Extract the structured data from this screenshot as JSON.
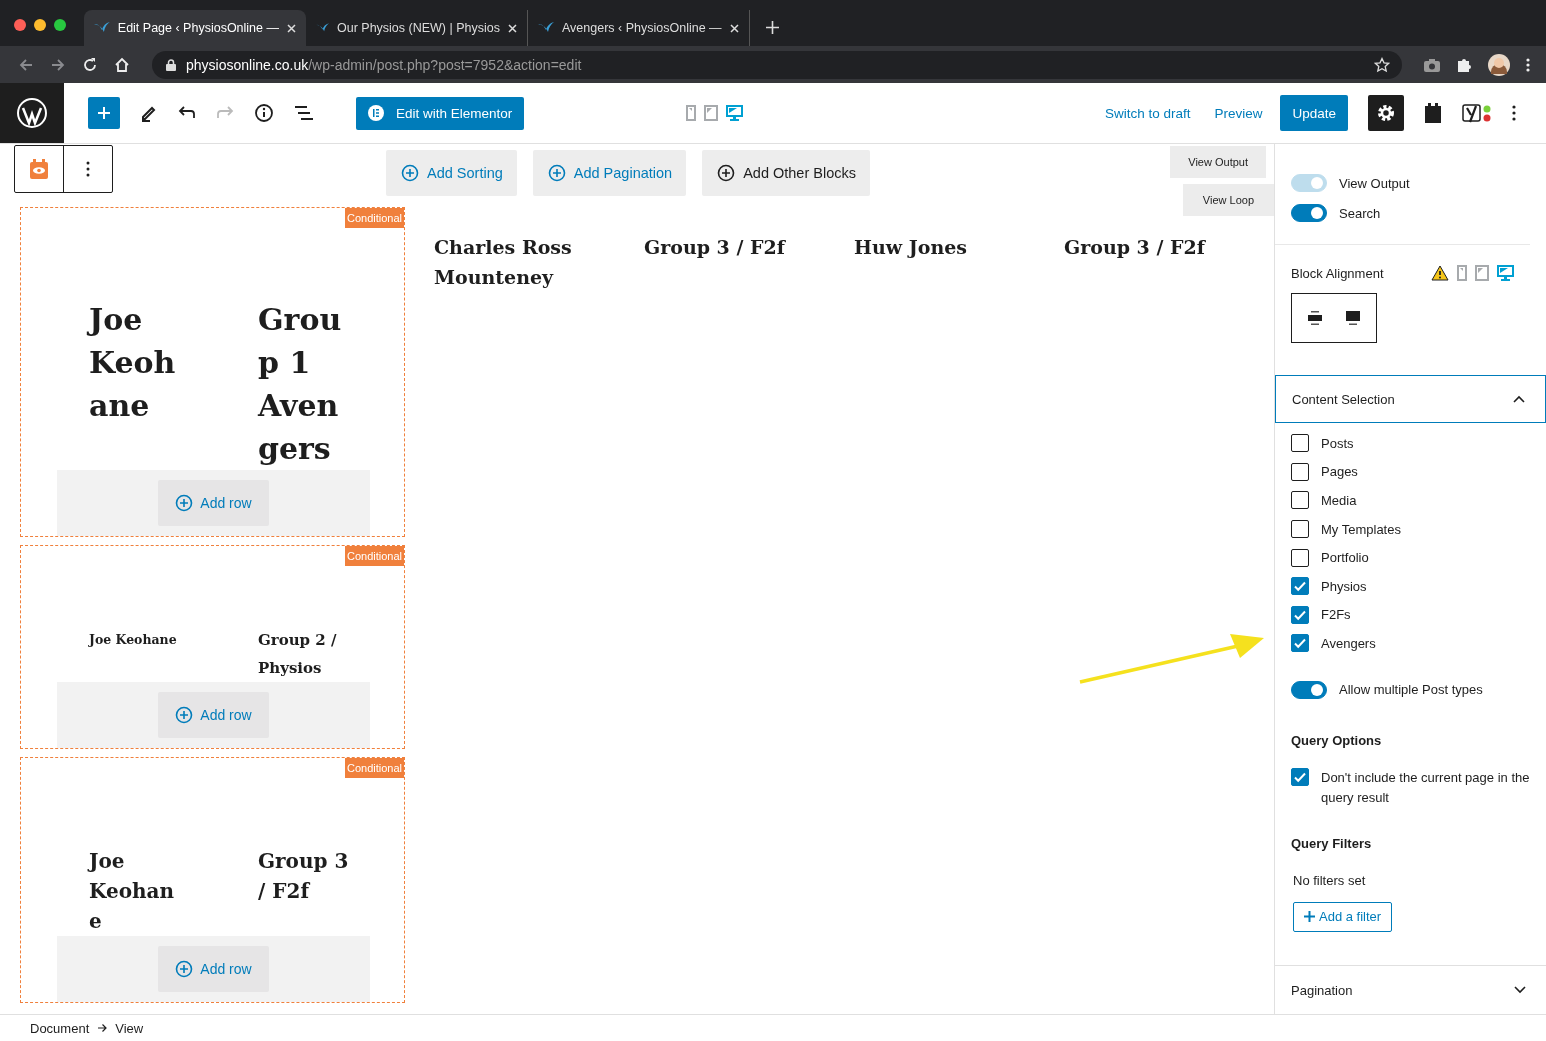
{
  "browser": {
    "tabs": [
      {
        "title": "Edit Page ‹ PhysiosOnline —",
        "selected": true
      },
      {
        "title": "Our Physios (NEW) | Physios",
        "selected": false
      },
      {
        "title": "Avengers ‹ PhysiosOnline —",
        "selected": false
      }
    ],
    "url": {
      "host": "physiosonline.co.uk",
      "path": "/wp-admin/post.php?post=7952&action=edit"
    }
  },
  "toolbar": {
    "elementor_button": "Edit with Elementor",
    "devices": [
      {
        "kind": "mobile",
        "selected": false
      },
      {
        "kind": "tablet",
        "selected": false
      },
      {
        "kind": "desktop",
        "selected": true
      }
    ],
    "switch_to_draft": "Switch to draft",
    "preview": "Preview",
    "update": "Update"
  },
  "canvas": {
    "actions": [
      {
        "label": "Add Sorting",
        "kind": "primary"
      },
      {
        "label": "Add Pagination",
        "kind": "primary"
      },
      {
        "label": "Add Other Blocks",
        "kind": "dark"
      }
    ],
    "view_buttons": [
      "View Output",
      "View Loop"
    ],
    "conditional_blocks": [
      {
        "badge": "Conditional",
        "kind": "large",
        "columns": [
          "Joe Keohane",
          "Group 1 Avengers"
        ],
        "add_row": "Add row"
      },
      {
        "badge": "Conditional",
        "kind": "small",
        "columns": [
          "Joe Keohane",
          "Group 2 / Physios"
        ],
        "add_row": "Add row"
      },
      {
        "badge": "Conditional",
        "kind": "medium",
        "columns": [
          "Joe Keohane",
          "Group 3 / F2f"
        ],
        "add_row": "Add row"
      }
    ],
    "results": [
      "Charles Ross Mounteney",
      "Group 3 / F2f",
      "Huw Jones",
      "Group 3 / F2f"
    ]
  },
  "sidebar": {
    "view_toggles": [
      {
        "label": "View Output",
        "on": true,
        "disabled": true
      },
      {
        "label": "Search",
        "on": true,
        "disabled": false
      }
    ],
    "block_alignment": {
      "label": "Block Alignment",
      "devices": [
        {
          "kind": "mobile",
          "selected": false
        },
        {
          "kind": "tablet",
          "selected": false
        },
        {
          "kind": "desktop",
          "selected": true
        }
      ]
    },
    "content_selection": {
      "title": "Content Selection",
      "expanded": true,
      "post_types": [
        {
          "label": "Posts",
          "checked": false
        },
        {
          "label": "Pages",
          "checked": false
        },
        {
          "label": "Media",
          "checked": false
        },
        {
          "label": "My Templates",
          "checked": false
        },
        {
          "label": "Portfolio",
          "checked": false
        },
        {
          "label": "Physios",
          "checked": true
        },
        {
          "label": "F2Fs",
          "checked": true
        },
        {
          "label": "Avengers",
          "checked": true
        }
      ],
      "multiple_toggle": {
        "label": "Allow multiple Post types",
        "on": true
      },
      "query_options_title": "Query Options",
      "exclude_current": {
        "label": "Don't include the current page in the query result",
        "checked": true
      },
      "query_filters_title": "Query Filters",
      "no_filters": "No filters set",
      "add_filter": "Add a filter"
    },
    "pagination": {
      "title": "Pagination",
      "expanded": false
    }
  },
  "breadcrumb": [
    "Document",
    "View"
  ]
}
